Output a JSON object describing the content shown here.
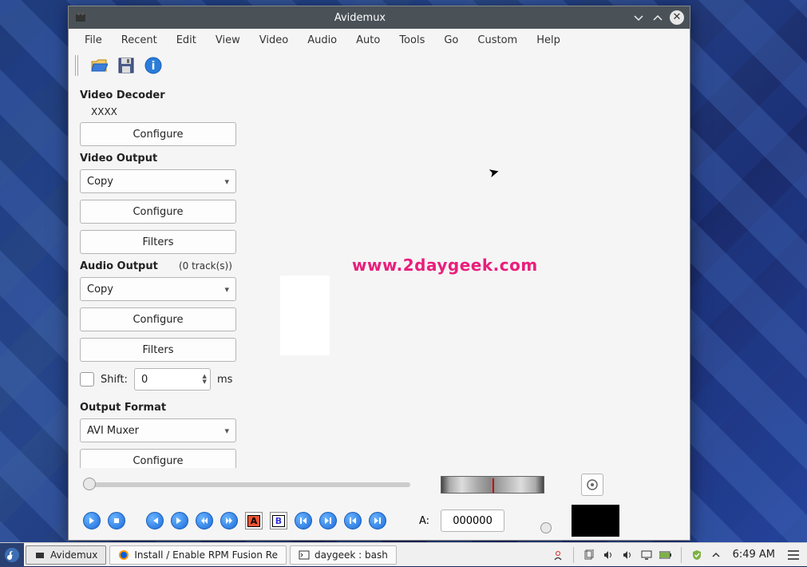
{
  "window": {
    "title": "Avidemux"
  },
  "menu": {
    "file": "File",
    "recent": "Recent",
    "edit": "Edit",
    "view": "View",
    "video": "Video",
    "audio": "Audio",
    "auto": "Auto",
    "tools": "Tools",
    "go": "Go",
    "custom": "Custom",
    "help": "Help"
  },
  "panel": {
    "video_decoder_title": "Video Decoder",
    "decoder_value": "XXXX",
    "video_output_title": "Video Output",
    "video_output_value": "Copy",
    "audio_output_title": "Audio Output",
    "audio_tracks": "(0 track(s))",
    "audio_output_value": "Copy",
    "shift_label": "Shift:",
    "shift_value": "0",
    "shift_unit": "ms",
    "output_format_title": "Output Format",
    "output_format_value": "AVI Muxer",
    "configure_label": "Configure",
    "filters_label": "Filters"
  },
  "watermark": "www.2daygeek.com",
  "transport": {
    "a_label": "A:",
    "frame_value": "000000"
  },
  "taskbar": {
    "task1": "Avidemux",
    "task2": "Install / Enable RPM Fusion Re",
    "task3": "daygeek : bash",
    "clock": "6:49 AM"
  }
}
